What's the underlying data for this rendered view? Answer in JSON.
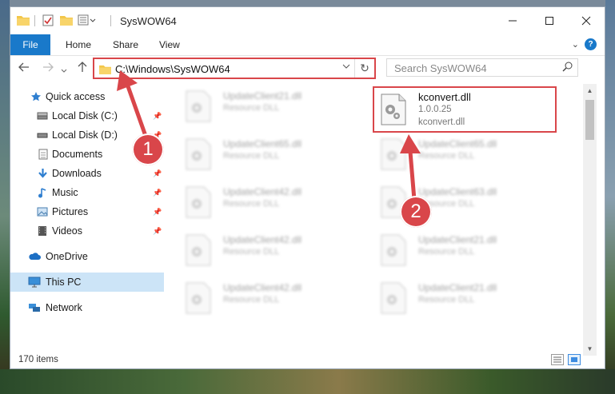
{
  "window": {
    "title": "SysWOW64"
  },
  "ribbon": {
    "tabs": [
      "File",
      "Home",
      "Share",
      "View"
    ]
  },
  "address": {
    "path": "C:\\Windows\\SysWOW64"
  },
  "search": {
    "placeholder": "Search SysWOW64"
  },
  "sidebar": {
    "items": [
      {
        "label": "Quick access",
        "icon": "star-icon"
      },
      {
        "label": "Local Disk (C:)",
        "icon": "drive-icon",
        "pinned": true
      },
      {
        "label": "Local Disk (D:)",
        "icon": "drive-icon",
        "pinned": true
      },
      {
        "label": "Documents",
        "icon": "documents-icon",
        "pinned": true
      },
      {
        "label": "Downloads",
        "icon": "downloads-icon",
        "pinned": true
      },
      {
        "label": "Music",
        "icon": "music-icon",
        "pinned": true
      },
      {
        "label": "Pictures",
        "icon": "pictures-icon",
        "pinned": true
      },
      {
        "label": "Videos",
        "icon": "videos-icon",
        "pinned": true
      },
      {
        "label": "OneDrive",
        "icon": "cloud-icon"
      },
      {
        "label": "This PC",
        "icon": "computer-icon",
        "selected": true
      },
      {
        "label": "Network",
        "icon": "network-icon"
      }
    ]
  },
  "files": [
    {
      "name": "UpdateClient21.dll",
      "desc": "Resource DLL"
    },
    {
      "name": "UpdateClient65.dll",
      "desc": "Resource DLL"
    },
    {
      "name": "UpdateClient42.dll",
      "desc": "Resource DLL"
    },
    {
      "name": "UpdateClient42.dll",
      "desc": "Resource DLL"
    },
    {
      "name": "UpdateClient42.dll",
      "desc": "Resource DLL"
    },
    {
      "name": "UpdateClient65.dll",
      "desc": "Resource DLL"
    },
    {
      "name": "UpdateClient63.dll",
      "desc": "Resource DLL"
    },
    {
      "name": "UpdateClient21.dll",
      "desc": "Resource DLL"
    },
    {
      "name": "UpdateClient21.dll",
      "desc": "Resource DLL"
    }
  ],
  "highlighted_file": {
    "name": "kconvert.dll",
    "version": "1.0.0.25",
    "desc": "kconvert.dll"
  },
  "status": {
    "item_count": "170 items"
  },
  "callouts": [
    "1",
    "2"
  ],
  "colors": {
    "accent": "#1979ca",
    "highlight": "#d9464a",
    "selected": "#cce4f7"
  }
}
